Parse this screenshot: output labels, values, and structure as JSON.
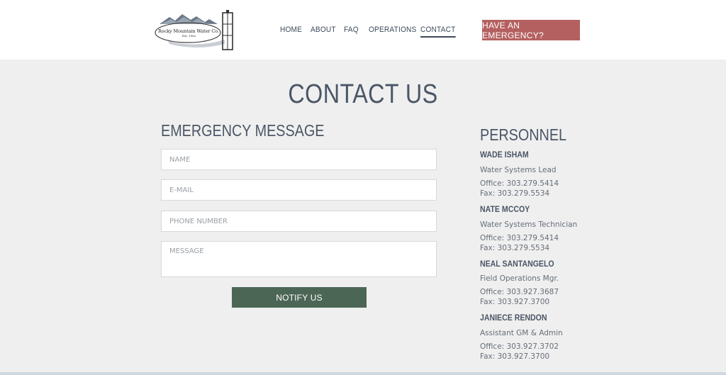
{
  "header": {
    "logo": {
      "name": "Rocky Mountain Water Co.",
      "tagline": "Est. 1962"
    },
    "nav": [
      {
        "label": "HOME"
      },
      {
        "label": "ABOUT"
      },
      {
        "label": "FAQ"
      },
      {
        "label": "OPERATIONS"
      },
      {
        "label": "CONTACT",
        "active": true
      }
    ],
    "emergency_button": "HAVE AN EMERGENCY?"
  },
  "page": {
    "title": "CONTACT US"
  },
  "form": {
    "title": "EMERGENCY MESSAGE",
    "name_placeholder": "NAME",
    "email_placeholder": "E-MAIL",
    "phone_placeholder": "PHONE NUMBER",
    "message_placeholder": "MESSAGE",
    "submit_label": "NOTIFY US"
  },
  "personnel": {
    "title": "PERSONNEL",
    "people": [
      {
        "name": "WADE ISHAM",
        "role": "Water Systems Lead",
        "office": "Office: 303.279.5414",
        "fax": "Fax: 303.279.5534"
      },
      {
        "name": "NATE MCCOY",
        "role": "Water Systems Technician",
        "office": "Office: 303.279.5414",
        "fax": "Fax: 303.279.5534"
      },
      {
        "name": "NEAL SANTANGELO",
        "role": "Field Operations Mgr.",
        "office": "Office: 303.927.3687",
        "fax": "Fax: 303.927.3700"
      },
      {
        "name": "JANIECE RENDON",
        "role": "Assistant GM & Admin",
        "office": "Office: 303.927.3702",
        "fax": "Fax: 303.927.3700"
      }
    ]
  },
  "colors": {
    "accent_emergency": "#b56060",
    "accent_submit": "#4c6656",
    "heading": "#4a5666",
    "background": "#efefef"
  }
}
